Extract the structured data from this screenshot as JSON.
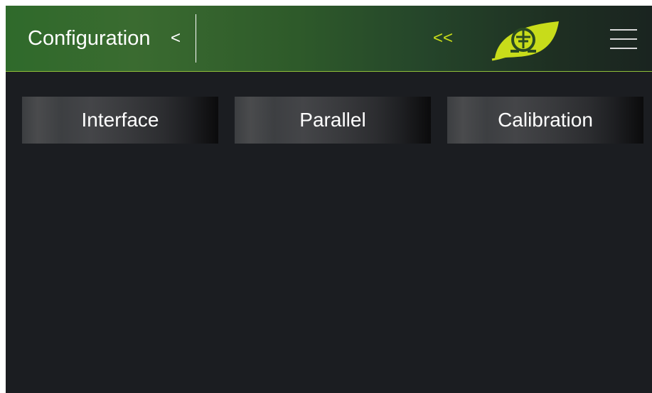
{
  "header": {
    "title": "Configuration",
    "title_chevron": "<",
    "collapse_glyph": "<<",
    "logo_icon": "leaf-ohm-logo",
    "menu_icon": "hamburger-menu-icon"
  },
  "tabs": [
    {
      "label": "Interface"
    },
    {
      "label": "Parallel"
    },
    {
      "label": "Calibration"
    }
  ],
  "colors": {
    "header_green": "#2f6a2b",
    "accent_lime": "#c8dc1a",
    "background": "#1b1d21"
  }
}
